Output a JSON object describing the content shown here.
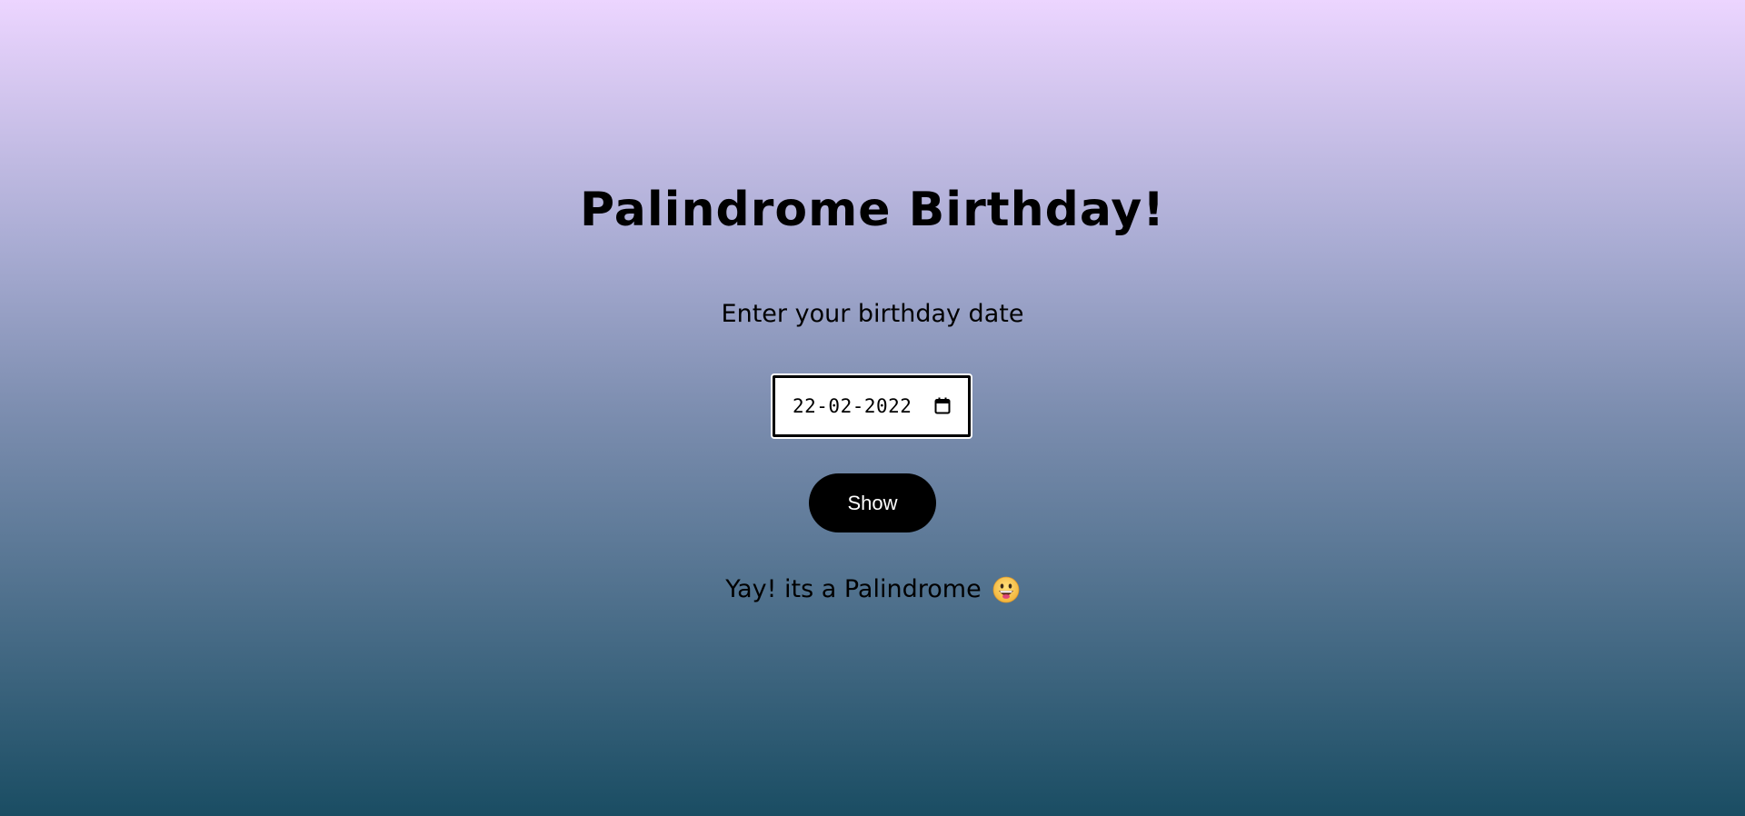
{
  "page": {
    "title": "Palindrome Birthday!",
    "prompt": "Enter your birthday date"
  },
  "date_input": {
    "value": "22-02-2022",
    "icon": "calendar-icon"
  },
  "show_button": {
    "label": "Show"
  },
  "result": {
    "text": "Yay! its a Palindrome",
    "icon": "grinning-face-icon"
  },
  "colors": {
    "gradient_top": "#ecd5ff",
    "gradient_bottom": "#1a4d63",
    "button_bg": "#000000",
    "button_text": "#ffffff"
  }
}
